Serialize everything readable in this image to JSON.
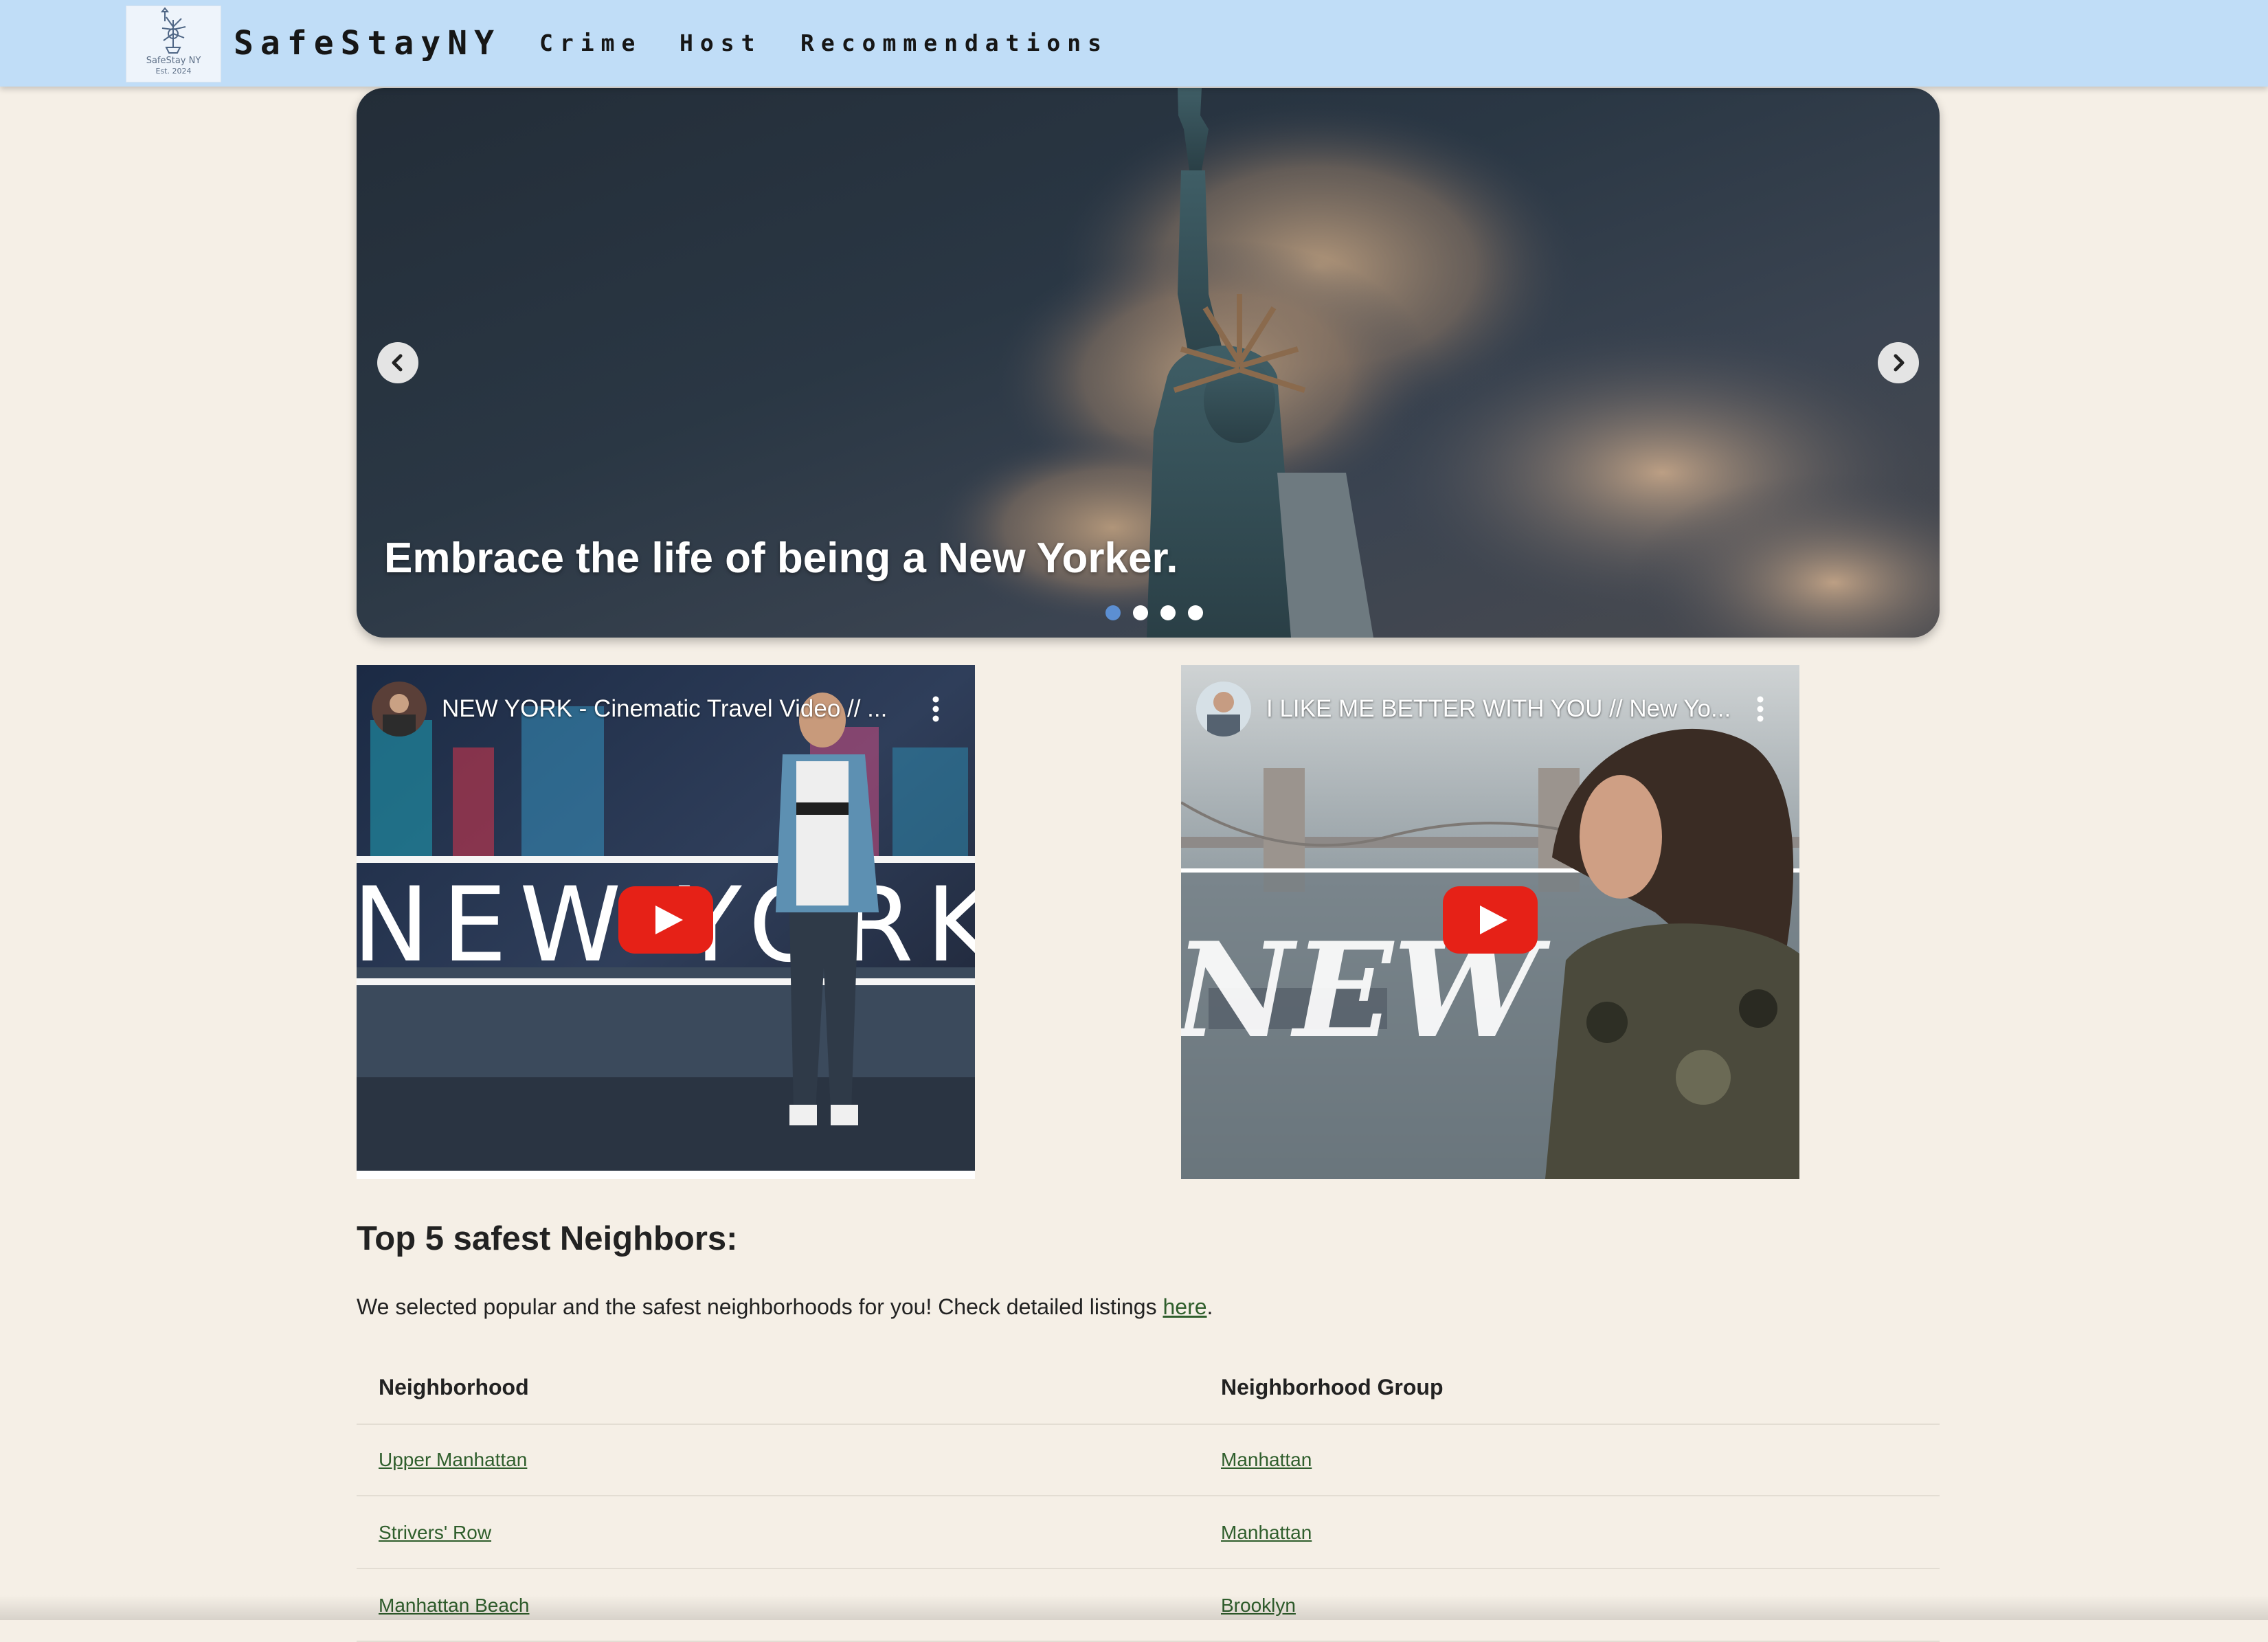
{
  "navbar": {
    "logo_line1": "SafeStay NY",
    "logo_line2": "Est. 2024",
    "brand": "SafeStayNY",
    "links": [
      "Crime",
      "Host",
      "Recommendations"
    ]
  },
  "carousel": {
    "caption": "Embrace the life of being a New Yorker.",
    "slide_count": 4,
    "active_index": 0,
    "prev_icon": "chevron-left-icon",
    "next_icon": "chevron-right-icon"
  },
  "videos": [
    {
      "title": "NEW YORK - Cinematic Travel Video // ...",
      "thumbnail_text": "NEW YORK",
      "icon": "youtube-play-icon"
    },
    {
      "title": "I LIKE ME BETTER WITH YOU // New Yo...",
      "thumbnail_text": "NEW YORK",
      "icon": "youtube-play-icon"
    }
  ],
  "section": {
    "title": "Top 5 safest Neighbors:",
    "intro_text": "We selected popular and the safest neighborhoods for you! Check detailed listings ",
    "intro_link": "here",
    "intro_end": "."
  },
  "table": {
    "headers": [
      "Neighborhood",
      "Neighborhood Group"
    ],
    "rows": [
      [
        "Upper Manhattan",
        "Manhattan"
      ],
      [
        "Strivers' Row",
        "Manhattan"
      ],
      [
        "Manhattan Beach",
        "Brooklyn"
      ]
    ]
  },
  "colors": {
    "navbar_bg": "#c0ddf7",
    "page_bg": "#f5efe6",
    "link_green": "#2f5e2c",
    "active_dot": "#5c8fd2",
    "youtube_red": "#e62117"
  }
}
